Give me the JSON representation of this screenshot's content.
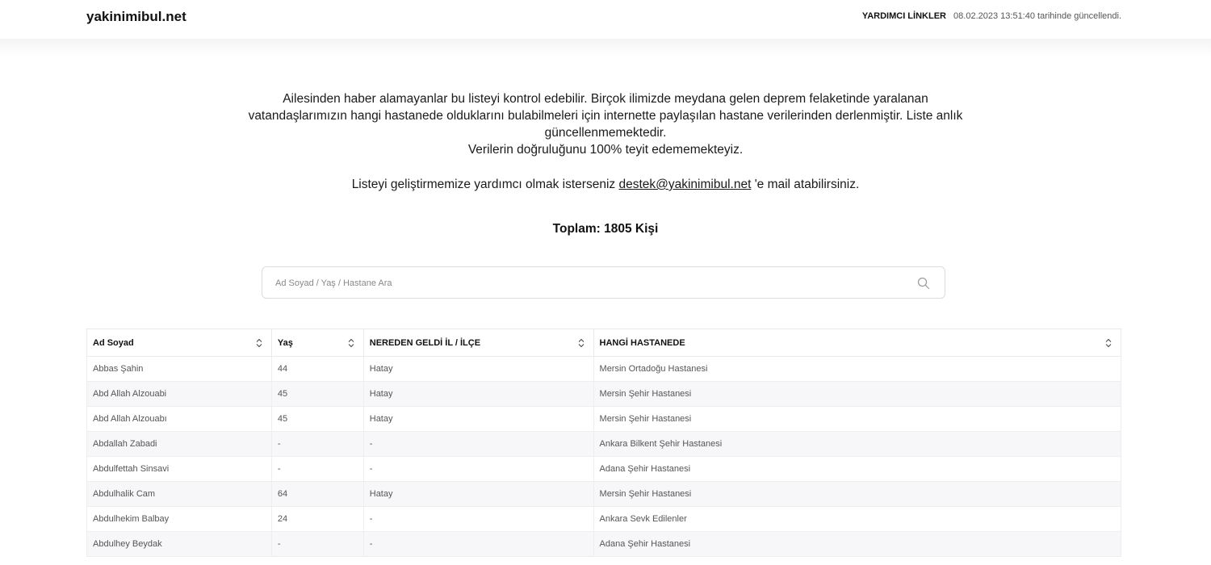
{
  "header": {
    "brand": "yakinimibul.net",
    "links_label": "YARDIMCI LİNKLER",
    "updated_text": "08.02.2023 13:51:40 tarihinde güncellendi."
  },
  "intro": {
    "paragraph": "Ailesinden haber alamayanlar bu listeyi kontrol edebilir. Birçok ilimizde meydana gelen deprem felaketinde yaralanan vatandaşlarımızın hangi hastanede olduklarını bulabilmeleri için internette paylaşılan hastane verilerinden derlenmiştir. Liste anlık güncellenmemektedir.",
    "accuracy": "Verilerin doğruluğunu 100% teyit edememekteyiz.",
    "contact_prefix": "Listeyi geliştirmemize yardımcı olmak isterseniz ",
    "contact_email": "destek@yakinimibul.net",
    "contact_suffix": " 'e mail atabilirsiniz."
  },
  "total": "Toplam: 1805 Kişi",
  "search": {
    "placeholder": "Ad Soyad / Yaş / Hastane Ara",
    "value": "",
    "icon": "search-icon"
  },
  "table": {
    "columns": [
      "Ad Soyad",
      "Yaş",
      "NEREDEN GELDİ İL / İLÇE",
      "HANGİ HASTANEDE"
    ],
    "rows": [
      [
        "Abbas Şahin",
        "44",
        "Hatay",
        "Mersin Ortadoğu Hastanesi"
      ],
      [
        "Abd Allah Alzouabi",
        "45",
        "Hatay",
        "Mersin Şehir Hastanesi"
      ],
      [
        "Abd Allah Alzouabı",
        "45",
        "Hatay",
        "Mersin Şehir Hastanesi"
      ],
      [
        "Abdallah Zabadi",
        "-",
        "-",
        "Ankara Bilkent Şehir Hastanesi"
      ],
      [
        "Abdulfettah Sinsavi",
        "-",
        "-",
        "Adana Şehir Hastanesi"
      ],
      [
        "Abdulhalik Cam",
        "64",
        "Hatay",
        "Mersin Şehir Hastanesi"
      ],
      [
        "Abdulhekim Balbay",
        "24",
        "-",
        "Ankara Sevk Edilenler"
      ],
      [
        "Abdulhey Beydak",
        "-",
        "-",
        "Adana Şehir Hastanesi"
      ]
    ]
  },
  "colors": {
    "text": "#111111",
    "muted": "#555555",
    "border": "#eaeaea",
    "row_alt": "#f7f7f9"
  }
}
